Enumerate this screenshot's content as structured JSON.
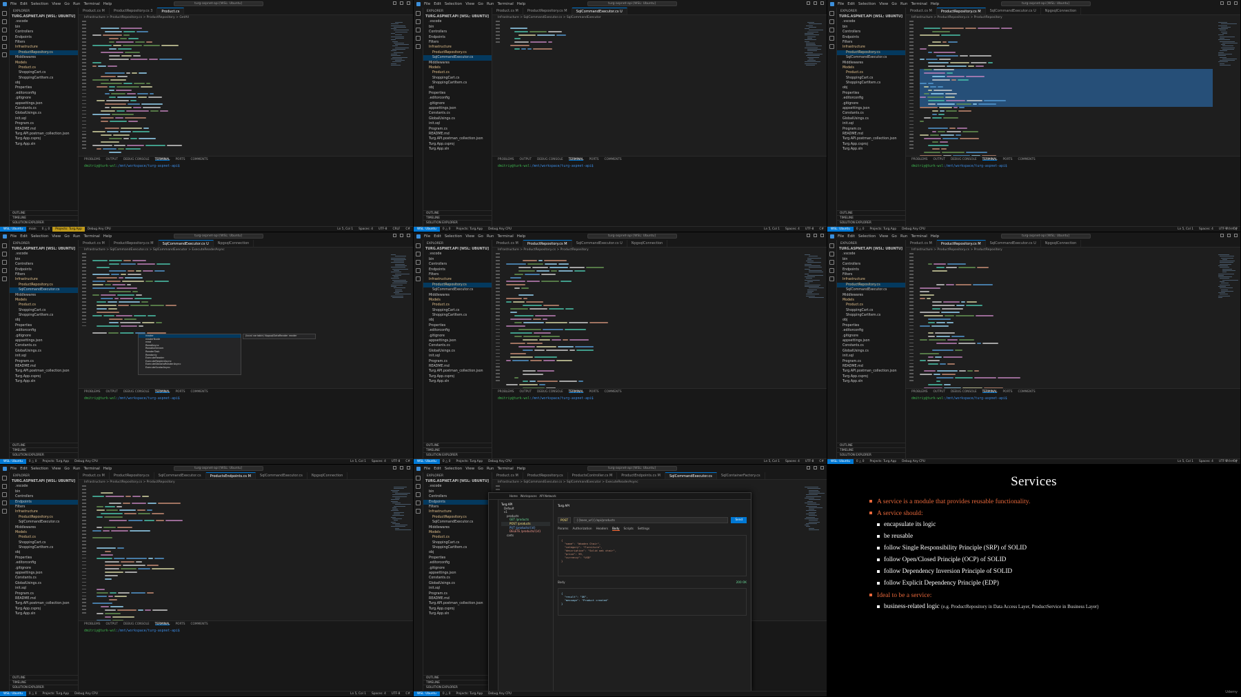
{
  "menu": [
    "File",
    "Edit",
    "Selection",
    "View",
    "Go",
    "Run",
    "Terminal",
    "Help"
  ],
  "search_box": "turg-aspnet-api [WSL: Ubuntu]",
  "explorer": {
    "header": "EXPLORER",
    "root": "TURG.ASPNET.API [WSL: UBUNTU]",
    "items": [
      ".vscode",
      "bin",
      "Controllers",
      "Endpoints",
      "Filters",
      "Infrastructure",
      "ProductRepository.cs",
      "SqlCommandExecutor.cs",
      "Middlewares",
      "Models",
      "Product.cs",
      "ShoppingCart.cs",
      "ShoppingCartItem.cs",
      "obj",
      "Properties",
      ".editorconfig",
      ".gitignore",
      "appsettings.json",
      "Constants.cs",
      "GlobalUsings.cs",
      "init.sql",
      "Program.cs",
      "README.md",
      "Turg.API.postman_collection.json",
      "Turg.App.csproj",
      "Turg.App.sln"
    ],
    "outline": "OUTLINE",
    "timeline": "TIMELINE",
    "solution": "SOLUTION EXPLORER"
  },
  "tabs": {
    "t1": [
      "Product.cs M",
      "ProductRepository.cs 3",
      "Product.cs"
    ],
    "t2": [
      "Product.cs M",
      "ProductRepository.cs M",
      "SqlCommandExecutor.cs U"
    ],
    "t3": [
      "Product.cs M",
      "ProductRepository.cs M",
      "SqlCommandExecutor.cs U",
      "NpgsqlConnection"
    ],
    "t4": [
      "Product.cs M",
      "ProductRepository.cs",
      "SqlCommandExecutor.cs",
      "ProductsEndpoints.cs M",
      "SqlCommandExecutor.cs",
      "NpgsqlConnection"
    ],
    "t5": [
      "Product.cs M",
      "ProductRepository.cs",
      "ProductsController.cs M",
      "ProductEndpoints.cs M",
      "SqlCommandExecutor.cs",
      "SqlContainerFactory.cs"
    ]
  },
  "breadcrumbs": {
    "b1": "Infrastructure > ProductRepository.cs > ProductRepository > GetAll",
    "b2": "Infrastructure > SqlCommandExecutor.cs > SqlCommandExecutor",
    "b3": "Infrastructure > SqlCommandExecutor.cs > SqlCommandExecutor > ExecuteReaderAsync",
    "b4": "Infrastructure > ProductRepository.cs > ProductRepository"
  },
  "panel": {
    "tabs": [
      "PROBLEMS",
      "OUTPUT",
      "DEBUG CONSOLE",
      "TERMINAL",
      "PORTS",
      "COMMENTS"
    ],
    "active": "TERMINAL",
    "prompt_user": "dmitriy@turk-wsl",
    "prompt_path": ":/mnt/workspace/turg-aspnet-api$"
  },
  "status": {
    "remote": "WSL: Ubuntu",
    "branch": "main",
    "project": "Projects: Turg.App",
    "config": "Debug Any CPU",
    "position": "Ln 5, Col 1",
    "spaces": "Spaces: 4",
    "encoding": "UTF-8",
    "eol": "CRLF",
    "lang": "C#",
    "alerts": "0 △ 0"
  },
  "autocomplete": [
    "reader",
    "readerNode",
    "read",
    "ReadAsync",
    "ReadAsStream",
    "ReaderTask",
    "Readonly",
    "ExecuteReader",
    "ExecuteReaderAsync",
    "ExecuteDbDataReaderAsync",
    "ExecuteScalarAsync"
  ],
  "autocomplete_hint": "(local variable) NpgsqlDataReader reader",
  "api_client": {
    "title": "Turg API",
    "nav": [
      "Home",
      "Workspaces",
      "API Network"
    ],
    "tree": [
      "Turg API",
      "Default",
      "v1",
      "products",
      "GET /products",
      "POST /products",
      "PUT /products/{id}",
      "DELETE /products/{id}",
      "carts"
    ],
    "method": "POST",
    "url": "{{base_url}}/api/products",
    "send": "Send",
    "request_tabs": [
      "Params",
      "Authorization",
      "Headers",
      "Body",
      "Scripts",
      "Settings"
    ],
    "body": "{\n  \"name\": \"Wooden Chair\",\n  \"category\": \"Furniture\",\n  \"description\": \"Solid oak chair\",\n  \"price\": 99,\n  \"currency\": \"USD\"\n}",
    "response_label": "Body",
    "response_status": "200 OK",
    "response": "{\n  \"result\": \"OK\",\n  \"message\": \"Product created\"\n}"
  },
  "slide": {
    "title": "Services",
    "bullets": [
      {
        "level": 1,
        "text": "A service is a module that provides reusable functionality."
      },
      {
        "level": 1,
        "text": "A service should:"
      },
      {
        "level": 2,
        "text": "encapsulate its logic"
      },
      {
        "level": 2,
        "text": "be reusable"
      },
      {
        "level": 2,
        "text": "follow Single Responsibility Principle (SRP) of SOLID"
      },
      {
        "level": 2,
        "text": "follow Open/Closed Principle (OCP) of SOLID"
      },
      {
        "level": 2,
        "text": "follow Dependency Inversion Principle of SOLID"
      },
      {
        "level": 2,
        "text": "follow Explicit Dependency Principle (EDP)"
      },
      {
        "level": 1,
        "text": "Ideal to be a service:"
      },
      {
        "level": 2,
        "text": "business-related logic",
        "note": "(e.g. ProductRepository in Data Access Layer, ProductService in Business Layer)"
      }
    ],
    "watermark": "Udemy"
  },
  "watermark": "Udemy"
}
